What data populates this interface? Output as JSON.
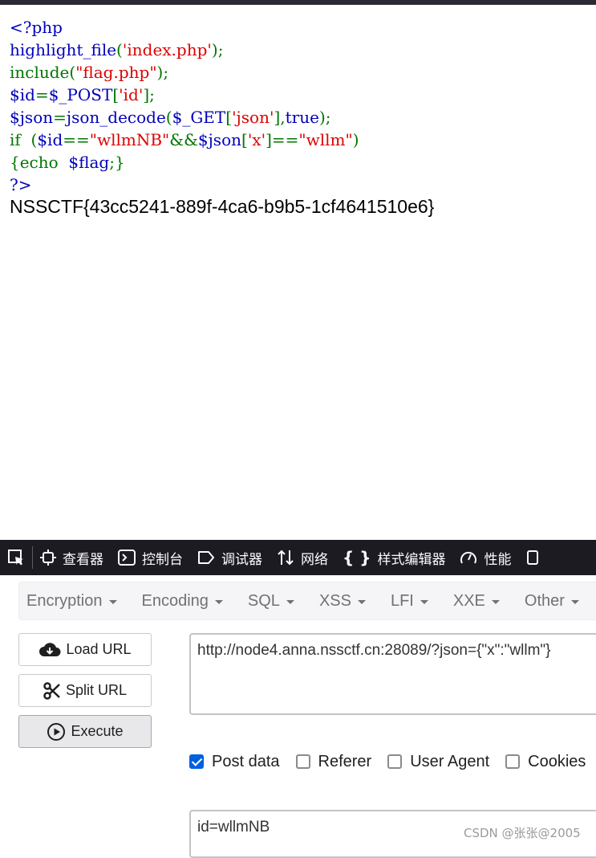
{
  "source": {
    "lines": [
      [
        {
          "t": "<?php",
          "c": "def"
        }
      ],
      [
        {
          "t": "highlight_file",
          "c": "def"
        },
        {
          "t": "(",
          "c": "kw"
        },
        {
          "t": "'index.php'",
          "c": "str"
        },
        {
          "t": ");",
          "c": "kw"
        }
      ],
      [
        {
          "t": "include(",
          "c": "kw"
        },
        {
          "t": "\"flag.php\"",
          "c": "str"
        },
        {
          "t": ");",
          "c": "kw"
        }
      ],
      [
        {
          "t": "$id",
          "c": "def"
        },
        {
          "t": "=",
          "c": "kw"
        },
        {
          "t": "$_POST",
          "c": "def"
        },
        {
          "t": "[",
          "c": "kw"
        },
        {
          "t": "'id'",
          "c": "str"
        },
        {
          "t": "];",
          "c": "kw"
        }
      ],
      [
        {
          "t": "$json",
          "c": "def"
        },
        {
          "t": "=",
          "c": "kw"
        },
        {
          "t": "json_decode",
          "c": "def"
        },
        {
          "t": "(",
          "c": "kw"
        },
        {
          "t": "$_GET",
          "c": "def"
        },
        {
          "t": "[",
          "c": "kw"
        },
        {
          "t": "'json'",
          "c": "str"
        },
        {
          "t": "],",
          "c": "kw"
        },
        {
          "t": "true",
          "c": "def"
        },
        {
          "t": ");",
          "c": "kw"
        }
      ],
      [
        {
          "t": "if  (",
          "c": "kw"
        },
        {
          "t": "$id",
          "c": "def"
        },
        {
          "t": "==",
          "c": "kw"
        },
        {
          "t": "\"wllmNB\"",
          "c": "str"
        },
        {
          "t": "&&",
          "c": "kw"
        },
        {
          "t": "$json",
          "c": "def"
        },
        {
          "t": "[",
          "c": "kw"
        },
        {
          "t": "'x'",
          "c": "str"
        },
        {
          "t": "]==",
          "c": "kw"
        },
        {
          "t": "\"wllm\"",
          "c": "str"
        },
        {
          "t": ")",
          "c": "kw"
        }
      ],
      [
        {
          "t": "{echo  ",
          "c": "kw"
        },
        {
          "t": "$flag",
          "c": "def"
        },
        {
          "t": ";}",
          "c": "kw"
        }
      ],
      [
        {
          "t": "?>",
          "c": "def"
        }
      ]
    ],
    "flag_output": "NSSCTF{43cc5241-889f-4ca6-b9b5-1cf4641510e6}"
  },
  "devtools": {
    "tabs": [
      {
        "label": "查看器",
        "icon": "inspector-icon"
      },
      {
        "label": "控制台",
        "icon": "console-icon"
      },
      {
        "label": "调试器",
        "icon": "debugger-icon"
      },
      {
        "label": "网络",
        "icon": "network-icon"
      },
      {
        "label": "样式编辑器",
        "icon": "style-editor-icon"
      },
      {
        "label": "性能",
        "icon": "performance-icon"
      }
    ]
  },
  "hackbar": {
    "menu": [
      "Encryption",
      "Encoding",
      "SQL",
      "XSS",
      "LFI",
      "XXE",
      "Other"
    ],
    "buttons": {
      "load": "Load URL",
      "split": "Split URL",
      "execute": "Execute"
    },
    "url": "http://node4.anna.nssctf.cn:28089/?json={\"x\":\"wllm\"}",
    "options": [
      {
        "label": "Post data",
        "checked": true
      },
      {
        "label": "Referer",
        "checked": false
      },
      {
        "label": "User Agent",
        "checked": false
      },
      {
        "label": "Cookies",
        "checked": false
      }
    ],
    "post_body": "id=wllmNB"
  },
  "watermark": "CSDN @张张@2005",
  "colors": {
    "php_default": "#0000bb",
    "php_keyword": "#007700",
    "php_string": "#dd0000",
    "devtools_bg": "#1c1b22",
    "checkbox_accent": "#0060df"
  }
}
